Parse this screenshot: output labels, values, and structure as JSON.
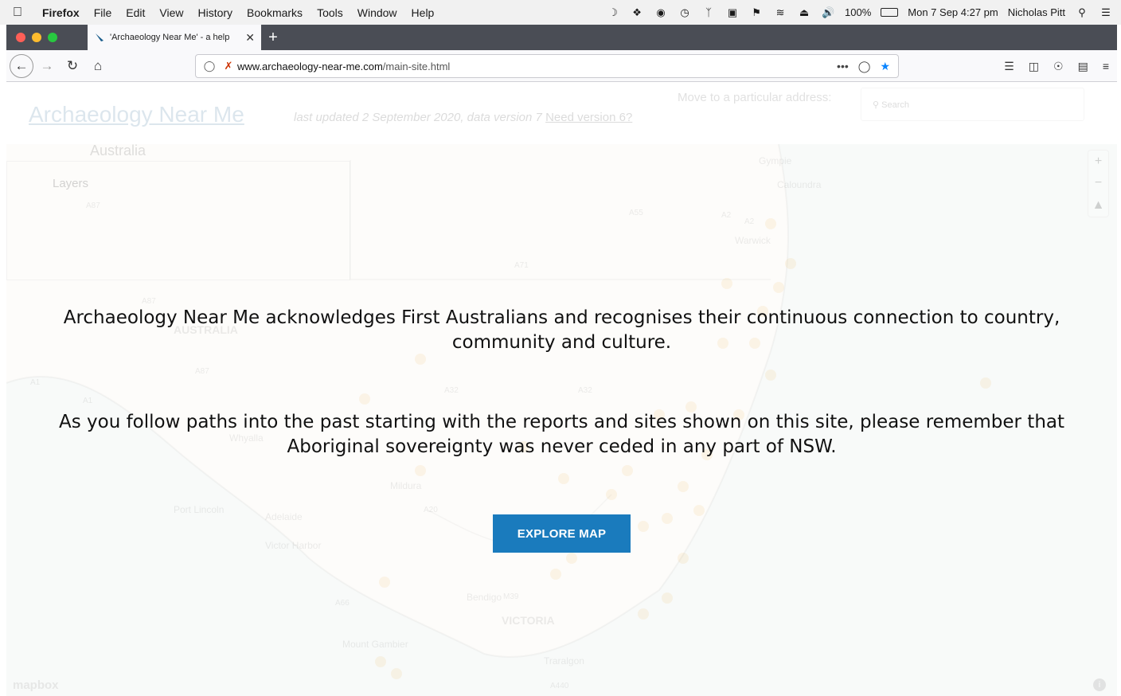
{
  "menubar": {
    "app_name": "Firefox",
    "items": [
      "File",
      "Edit",
      "View",
      "History",
      "Bookmarks",
      "Tools",
      "Window",
      "Help"
    ],
    "battery": "100%",
    "datetime": "Mon 7 Sep  4:27 pm",
    "user": "Nicholas Pitt"
  },
  "browser": {
    "tab_title": "'Archaeology Near Me' - a help",
    "url_domain": "www.archaeology-near-me.com",
    "url_path": "/main-site.html",
    "more_label": "•••"
  },
  "site": {
    "title": "Archaeology Near Me",
    "updated_text": "last updated 2 September 2020, data version 7",
    "need_version_link": "Need version 6?",
    "move_label": "Move to a particular address:",
    "search_placeholder": "Search",
    "region": "Australia",
    "layers": "Layers",
    "mapbox": "mapbox"
  },
  "acknowledgement": {
    "paragraph1": "Archaeology Near Me acknowledges First Australians and recognises their continuous connection to country, community and culture.",
    "paragraph2": "As you follow paths into the past starting with the reports and sites shown on this site, please remember that Aboriginal sovereignty was never ceded in any part of NSW.",
    "button_label": "EXPLORE MAP"
  },
  "map_labels": {
    "places": [
      "Gympie",
      "Caloundra",
      "Warwick",
      "Whyalla",
      "Port Lincoln",
      "Adelaide",
      "Victor Harbor",
      "Mildura",
      "Bendigo",
      "Mount Gambier",
      "Traralgon"
    ],
    "states": [
      "AUSTRALIA",
      "VICTORIA"
    ],
    "roads": [
      "A87",
      "A55",
      "A2",
      "A2",
      "A71",
      "A87",
      "A87",
      "A1",
      "A1",
      "A32",
      "A32",
      "A20",
      "M39",
      "A66",
      "A440"
    ]
  },
  "colors": {
    "accent": "#1a7bbd",
    "title_link": "#1a5d8c",
    "marker": "#f0a830"
  }
}
